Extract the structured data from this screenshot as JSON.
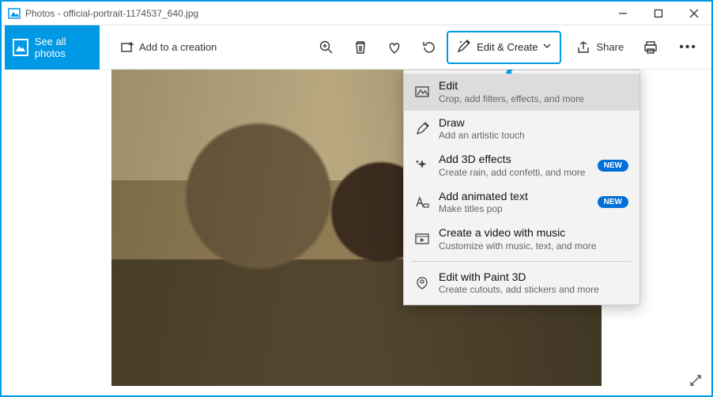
{
  "titlebar": {
    "app": "Photos",
    "separator": " - ",
    "filename": "official-portrait-1174537_640.jpg"
  },
  "toolbar": {
    "see_all": "See all photos",
    "add_creation": "Add to a creation",
    "edit_create": "Edit & Create",
    "share": "Share",
    "icons": {
      "zoom": "zoom-icon",
      "delete": "delete-icon",
      "favorite": "favorite-icon",
      "rotate": "rotate-icon",
      "print": "print-icon",
      "more": "more-icon"
    }
  },
  "menu": {
    "items": [
      {
        "title": "Edit",
        "sub": "Crop, add filters, effects, and more",
        "badge": ""
      },
      {
        "title": "Draw",
        "sub": "Add an artistic touch",
        "badge": ""
      },
      {
        "title": "Add 3D effects",
        "sub": "Create rain, add confetti, and more",
        "badge": "NEW"
      },
      {
        "title": "Add animated text",
        "sub": "Make titles pop",
        "badge": "NEW"
      },
      {
        "title": "Create a video with music",
        "sub": "Customize with music, text, and more",
        "badge": ""
      }
    ],
    "secondary": [
      {
        "title": "Edit with Paint 3D",
        "sub": "Create cutouts, add stickers and more",
        "badge": ""
      }
    ]
  }
}
